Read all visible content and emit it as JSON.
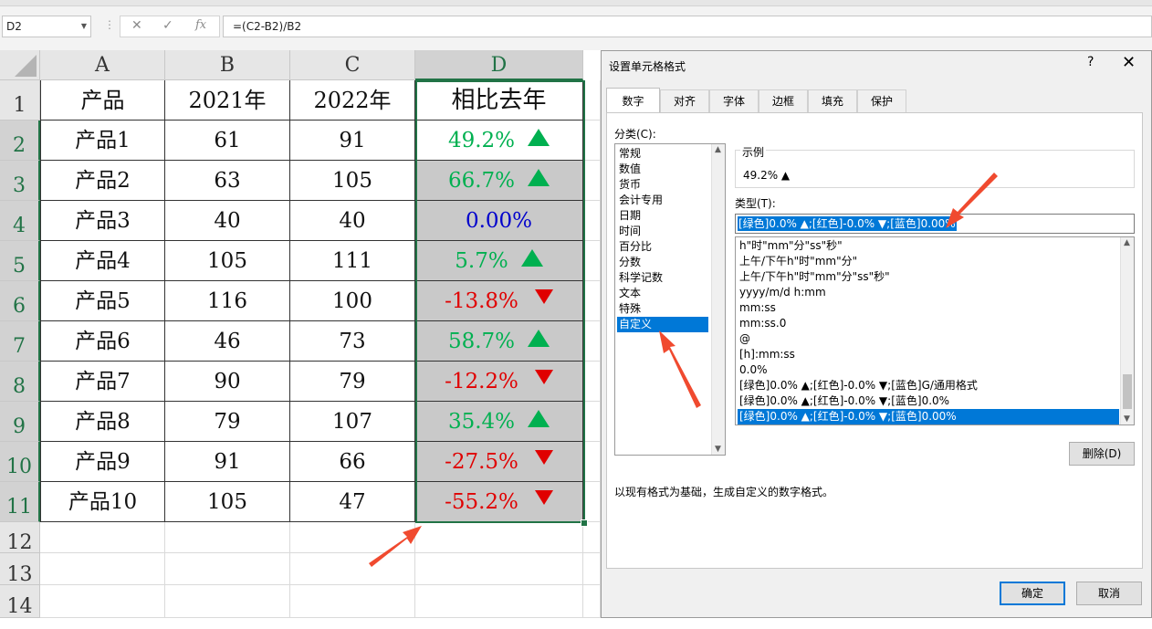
{
  "formula_bar": {
    "name_box": "D2",
    "cancel_icon": "✕",
    "enter_icon": "✓",
    "fx_label": "fx",
    "formula": "=(C2-B2)/B2"
  },
  "sheet": {
    "columns": [
      "A",
      "B",
      "C",
      "D"
    ],
    "rows": [
      "1",
      "2",
      "3",
      "4",
      "5",
      "6",
      "7",
      "8",
      "9",
      "10",
      "11",
      "12",
      "13",
      "14"
    ],
    "header": [
      "产品",
      "2021年",
      "2022年",
      "相比去年"
    ],
    "data": [
      {
        "product": "产品1",
        "y2021": "61",
        "y2022": "91",
        "change": "49.2%",
        "trend": "up"
      },
      {
        "product": "产品2",
        "y2021": "63",
        "y2022": "105",
        "change": "66.7%",
        "trend": "up"
      },
      {
        "product": "产品3",
        "y2021": "40",
        "y2022": "40",
        "change": "0.00%",
        "trend": "none"
      },
      {
        "product": "产品4",
        "y2021": "105",
        "y2022": "111",
        "change": "5.7%",
        "trend": "up"
      },
      {
        "product": "产品5",
        "y2021": "116",
        "y2022": "100",
        "change": "-13.8%",
        "trend": "down"
      },
      {
        "product": "产品6",
        "y2021": "46",
        "y2022": "73",
        "change": "58.7%",
        "trend": "up"
      },
      {
        "product": "产品7",
        "y2021": "90",
        "y2022": "79",
        "change": "-12.2%",
        "trend": "down"
      },
      {
        "product": "产品8",
        "y2021": "79",
        "y2022": "107",
        "change": "35.4%",
        "trend": "up"
      },
      {
        "product": "产品9",
        "y2021": "91",
        "y2022": "66",
        "change": "-27.5%",
        "trend": "down"
      },
      {
        "product": "产品10",
        "y2021": "105",
        "y2022": "47",
        "change": "-55.2%",
        "trend": "down"
      }
    ],
    "colors": {
      "up": "#00b050",
      "down": "#e00000",
      "zero": "#0000cc",
      "selection": "#217346"
    }
  },
  "dialog": {
    "title": "设置单元格格式",
    "help": "?",
    "close": "✕",
    "tabs": [
      "数字",
      "对齐",
      "字体",
      "边框",
      "填充",
      "保护"
    ],
    "category_label": "分类(C):",
    "categories": [
      "常规",
      "数值",
      "货币",
      "会计专用",
      "日期",
      "时间",
      "百分比",
      "分数",
      "科学记数",
      "文本",
      "特殊",
      "自定义"
    ],
    "selected_category": "自定义",
    "sample_label": "示例",
    "sample_value": "49.2% ▲",
    "type_label": "类型(T):",
    "type_value": "[绿色]0.0% ▲;[红色]-0.0% ▼;[蓝色]0.00%",
    "format_list": [
      "h\"时\"mm\"分\"ss\"秒\"",
      "上午/下午h\"时\"mm\"分\"",
      "上午/下午h\"时\"mm\"分\"ss\"秒\"",
      "yyyy/m/d h:mm",
      "mm:ss",
      "mm:ss.0",
      "@",
      "[h]:mm:ss",
      "0.0%",
      "[绿色]0.0% ▲;[红色]-0.0% ▼;[蓝色]G/通用格式",
      "[绿色]0.0% ▲;[红色]-0.0% ▼;[蓝色]0.0%",
      "[绿色]0.0% ▲;[红色]-0.0% ▼;[蓝色]0.00%"
    ],
    "selected_format_index": 11,
    "delete_button": "删除(D)",
    "note": "以现有格式为基础，生成自定义的数字格式。",
    "ok_button": "确定",
    "cancel_button": "取消"
  }
}
